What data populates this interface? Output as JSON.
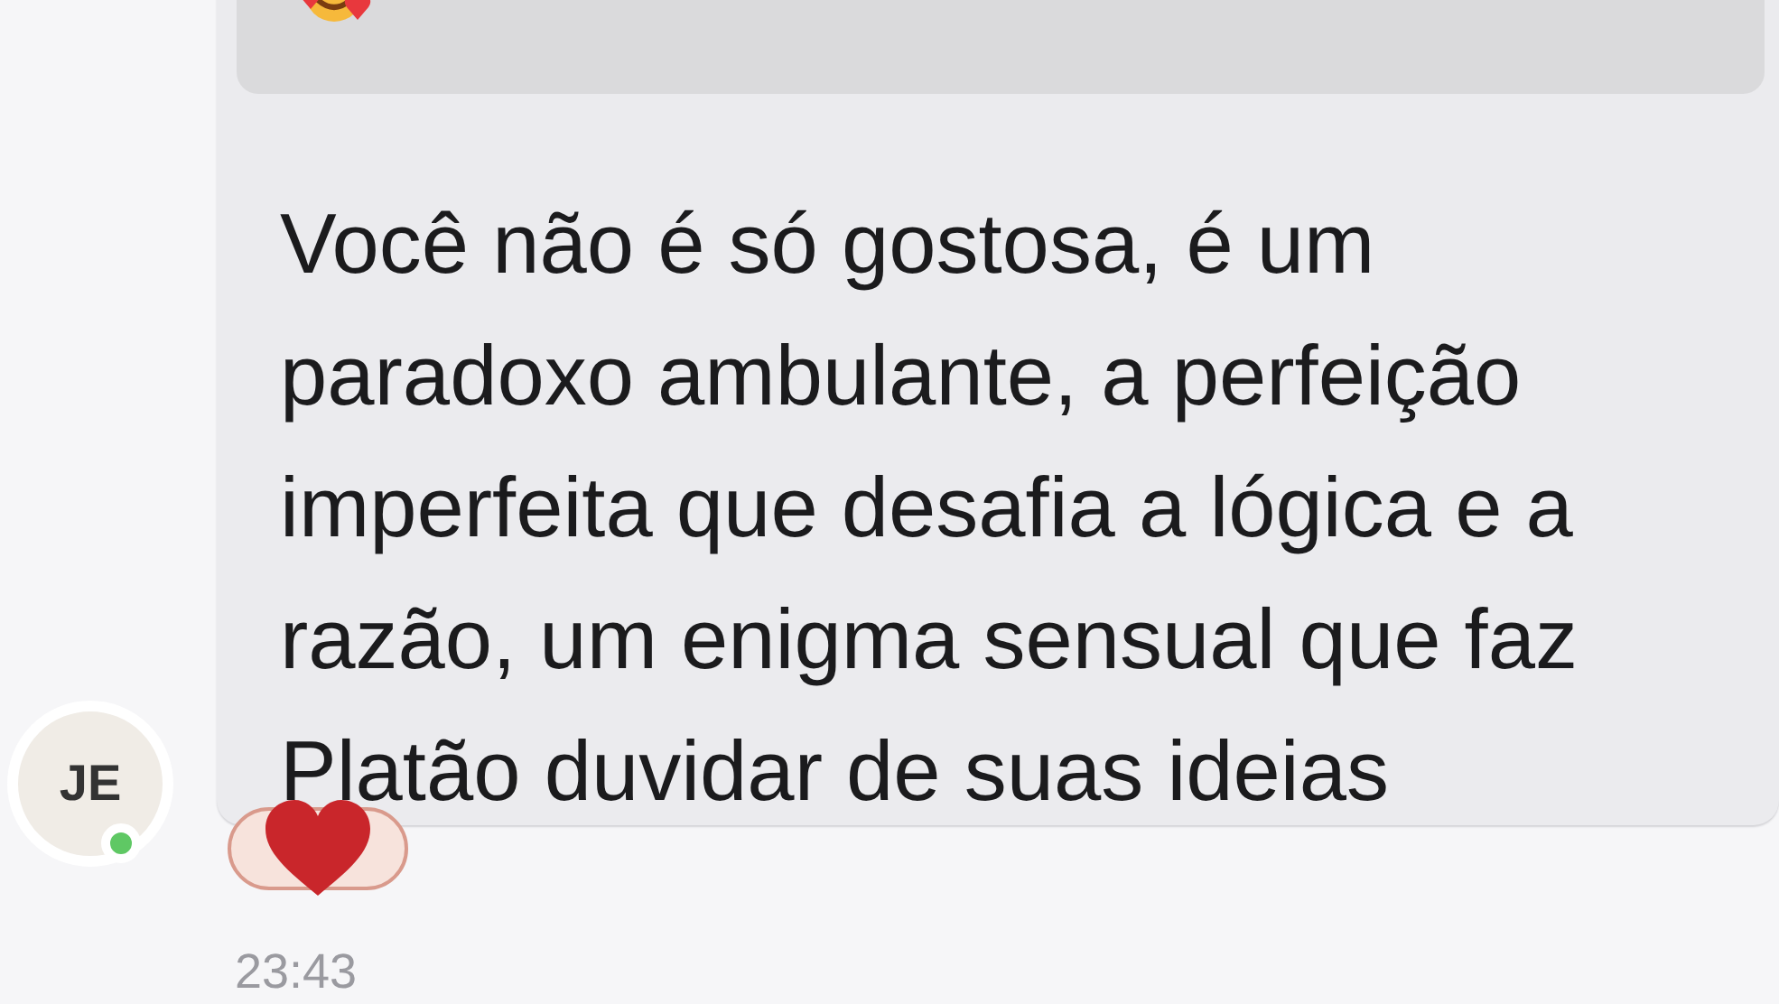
{
  "message": {
    "quoted": {
      "kind": "picture-emoji"
    },
    "text": "Você não é só gostosa, é um paradoxo ambulante, a perfeição imperfeita que desafia a lógica e a razão, um enigma sensual que faz Platão duvidar de suas ideias",
    "time": "23:43"
  },
  "sender": {
    "initials": "JE",
    "online": true
  },
  "reactions": [
    {
      "selected": true
    }
  ]
}
